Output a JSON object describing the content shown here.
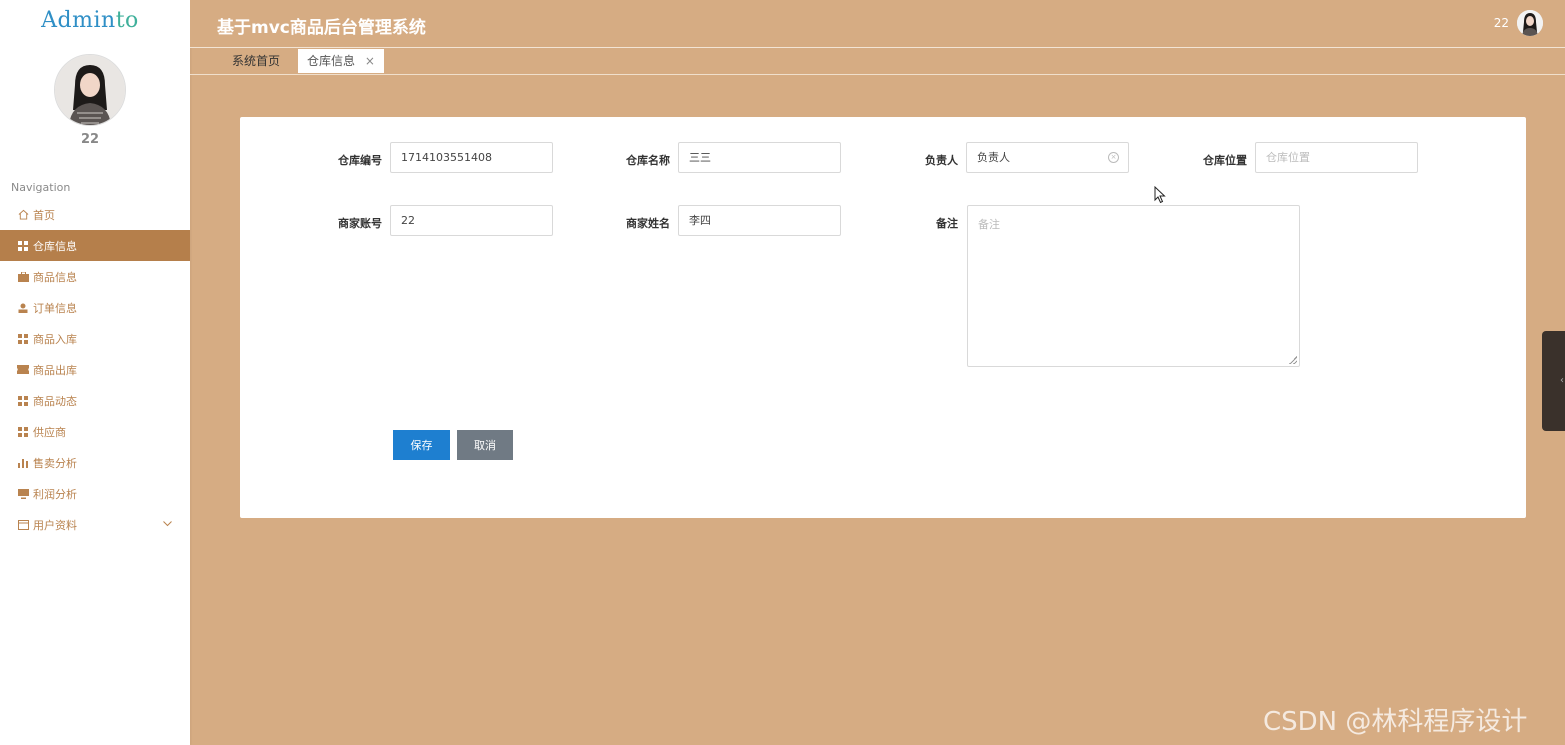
{
  "sidebar": {
    "logo": {
      "part1": "Admin",
      "part2": "to"
    },
    "user_name": "22",
    "nav_title": "Navigation",
    "items": [
      {
        "label": "首页",
        "icon": "home-icon"
      },
      {
        "label": "仓库信息",
        "icon": "grid-icon"
      },
      {
        "label": "商品信息",
        "icon": "briefcase-icon"
      },
      {
        "label": "订单信息",
        "icon": "user-icon"
      },
      {
        "label": "商品入库",
        "icon": "grid-icon"
      },
      {
        "label": "商品出库",
        "icon": "ticket-icon"
      },
      {
        "label": "商品动态",
        "icon": "grid-icon"
      },
      {
        "label": "供应商",
        "icon": "grid-icon"
      },
      {
        "label": "售卖分析",
        "icon": "bar-chart-icon"
      },
      {
        "label": "利润分析",
        "icon": "monitor-icon"
      },
      {
        "label": "用户资料",
        "icon": "card-icon"
      }
    ]
  },
  "header": {
    "title": "基于mvc商品后台管理系统",
    "user_name": "22"
  },
  "tabs": {
    "home": "系统首页",
    "current": "仓库信息",
    "close": "×"
  },
  "form": {
    "warehouse_no": {
      "label": "仓库编号",
      "value": "1714103551408"
    },
    "warehouse_name": {
      "label": "仓库名称",
      "value": "三三"
    },
    "manager": {
      "label": "负责人",
      "value": "负责人"
    },
    "location": {
      "label": "仓库位置",
      "placeholder": "仓库位置"
    },
    "merchant_account": {
      "label": "商家账号",
      "value": "22"
    },
    "merchant_name": {
      "label": "商家姓名",
      "value": "李四"
    },
    "remark": {
      "label": "备注",
      "placeholder": "备注"
    },
    "save_label": "保存",
    "cancel_label": "取消"
  },
  "watermark": "CSDN @林科程序设计",
  "colors": {
    "background": "#d6ac83",
    "sidebar_active": "#b57f4b",
    "nav_text": "#b9834f",
    "save_button": "#1e7fd0",
    "cancel_button": "#707a84"
  }
}
